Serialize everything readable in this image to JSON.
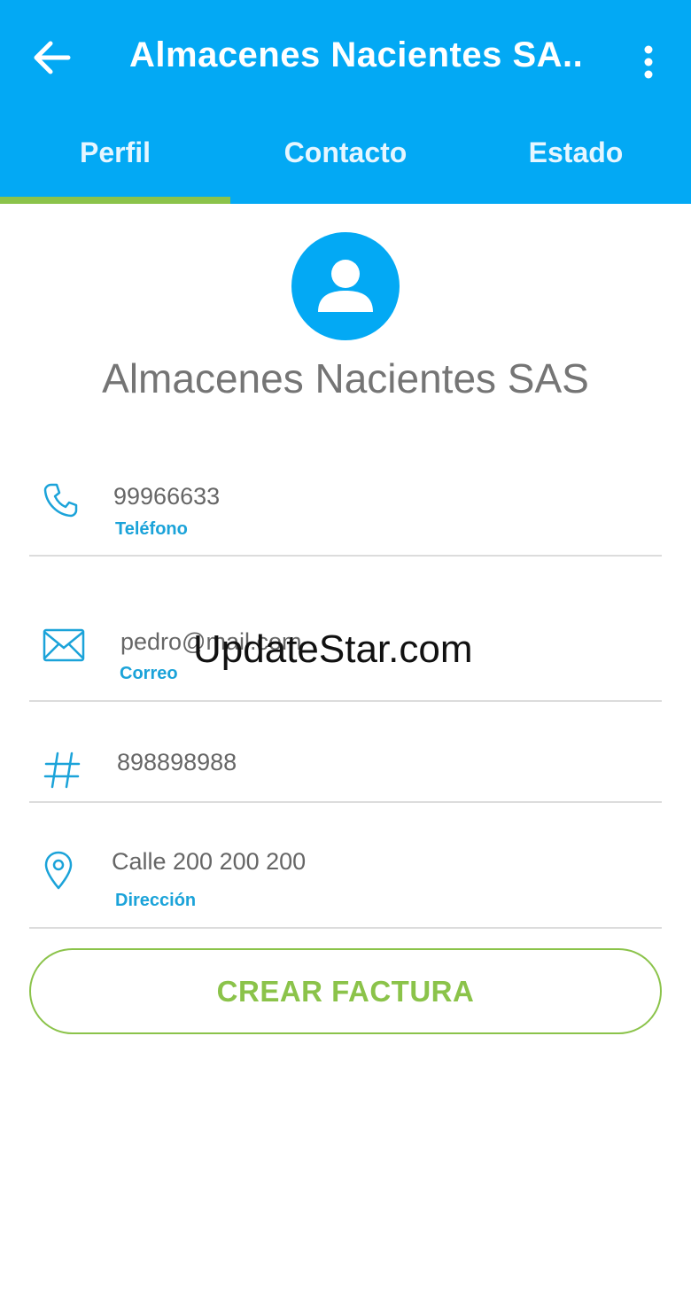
{
  "app_bar": {
    "title": "Almacenes Nacientes SA..",
    "back_icon": "arrow-left-icon",
    "menu_icon": "more-vert-icon"
  },
  "tabs": [
    {
      "label": "Perfil",
      "active": true
    },
    {
      "label": "Contacto",
      "active": false
    },
    {
      "label": "Estado",
      "active": false
    }
  ],
  "profile": {
    "avatar_icon": "person-icon",
    "name": "Almacenes Nacientes SAS"
  },
  "fields": {
    "phone": {
      "icon": "phone-icon",
      "value": "99966633",
      "label": "Teléfono"
    },
    "email": {
      "icon": "mail-icon",
      "value": "pedro@mail.com",
      "label": "Correo"
    },
    "id_number": {
      "icon": "hash-icon",
      "value": "898898988"
    },
    "address": {
      "icon": "location-pin-icon",
      "value": "Calle 200 200 200",
      "label": "Dirección"
    }
  },
  "actions": {
    "create_invoice": "CREAR FACTURA"
  },
  "watermark": "UpdateStar.com",
  "colors": {
    "primary": "#03a9f4",
    "accent": "#8bc34a",
    "label": "#1ba3d9",
    "text": "#666666"
  }
}
